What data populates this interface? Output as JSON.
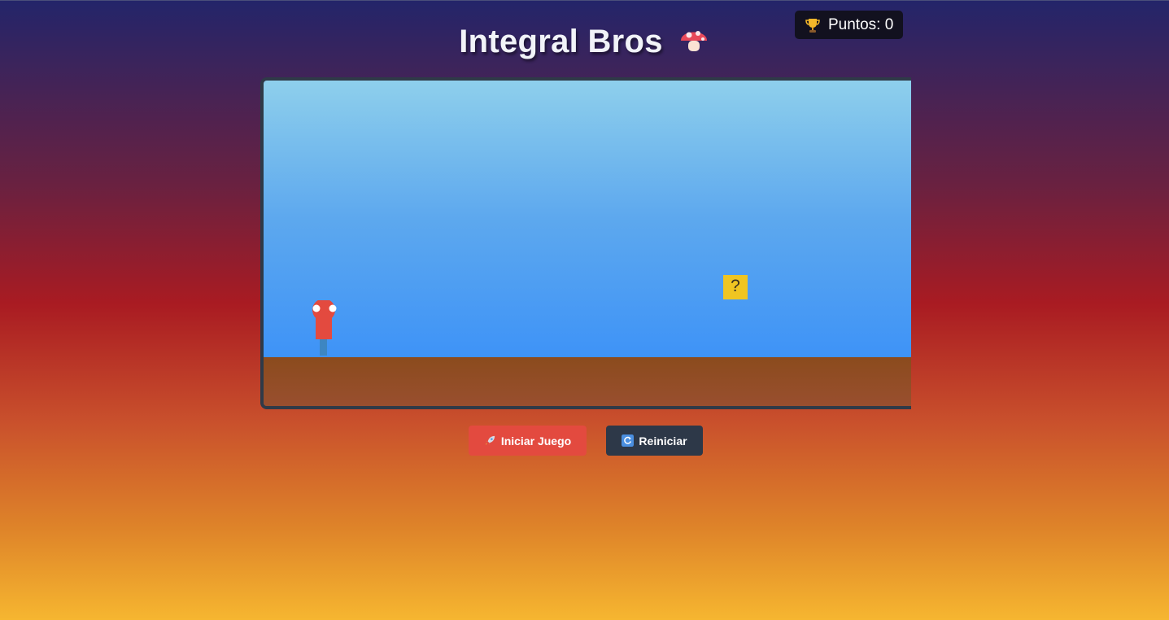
{
  "header": {
    "title": "Integral Bros",
    "title_icon": "mushroom-icon"
  },
  "score": {
    "icon": "trophy-icon",
    "label": "Puntos: 0"
  },
  "game": {
    "question_block_text": "?",
    "colors": {
      "sky_top": "#8ecfec",
      "sky_bottom": "#3e93f7",
      "ground": "#8b4b1d",
      "player": "#e34a3f",
      "question_block": "#f0c521"
    }
  },
  "controls": {
    "start_label": "Iniciar Juego",
    "start_icon": "rocket-icon",
    "reset_label": "Reiniciar",
    "reset_icon": "refresh-icon"
  }
}
